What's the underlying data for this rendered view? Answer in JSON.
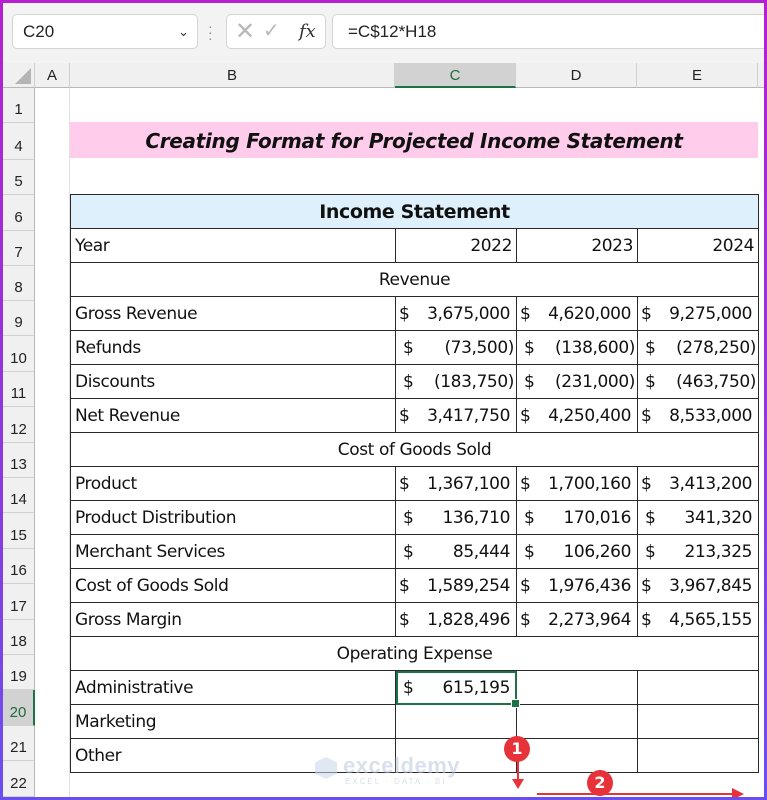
{
  "formula_bar": {
    "name_box": "C20",
    "name_box_chevron": "chevron-down-icon",
    "cancel_icon": "✕",
    "enter_icon": "✓",
    "fx_label": "fx",
    "formula": "=C$12*H18"
  },
  "columns": [
    {
      "label": "A",
      "selected": false
    },
    {
      "label": "B",
      "selected": false
    },
    {
      "label": "C",
      "selected": true
    },
    {
      "label": "D",
      "selected": false
    },
    {
      "label": "E",
      "selected": false
    }
  ],
  "rows": [
    "1",
    "4",
    "5",
    "6",
    "7",
    "8",
    "9",
    "10",
    "11",
    "12",
    "13",
    "14",
    "15",
    "16",
    "17",
    "18",
    "19",
    "20",
    "21",
    "22"
  ],
  "selected_row": "20",
  "sheet": {
    "title": "Creating Format for Projected Income Statement",
    "table_header": "Income Statement",
    "year_label": "Year",
    "years": [
      "2022",
      "2023",
      "2024"
    ],
    "sections": {
      "revenue": "Revenue",
      "cogs": "Cost of Goods Sold",
      "opex": "Operating Expense"
    },
    "revenue_rows": [
      {
        "label": "Gross Revenue",
        "values": [
          [
            "$",
            "3,675,000",
            "tight"
          ],
          [
            "$",
            "4,620,000",
            "tight"
          ],
          [
            "$",
            "9,275,000",
            "tight"
          ]
        ]
      },
      {
        "label": "Refunds",
        "values": [
          [
            "$",
            "(73,500)",
            "neg"
          ],
          [
            "$",
            "(138,600)",
            "neg"
          ],
          [
            "$",
            "(278,250)",
            "neg"
          ]
        ]
      },
      {
        "label": "Discounts",
        "values": [
          [
            "$",
            "(183,750)",
            "neg"
          ],
          [
            "$",
            "(231,000)",
            "neg"
          ],
          [
            "$",
            "(463,750)",
            "neg"
          ]
        ]
      },
      {
        "label": "Net Revenue",
        "values": [
          [
            "$",
            "3,417,750",
            "tight"
          ],
          [
            "$",
            "4,250,400",
            "tight"
          ],
          [
            "$",
            "8,533,000",
            "tight"
          ]
        ]
      }
    ],
    "cogs_rows": [
      {
        "label": "Product",
        "values": [
          [
            "$",
            "1,367,100",
            "tight"
          ],
          [
            "$",
            "1,700,160",
            "tight"
          ],
          [
            "$",
            "3,413,200",
            "tight"
          ]
        ]
      },
      {
        "label": "Product Distribution",
        "values": [
          [
            "$",
            "136,710",
            "pos"
          ],
          [
            "$",
            "170,016",
            "pos"
          ],
          [
            "$",
            "341,320",
            "pos"
          ]
        ]
      },
      {
        "label": "Merchant Services",
        "values": [
          [
            "$",
            "85,444",
            "pos"
          ],
          [
            "$",
            "106,260",
            "pos"
          ],
          [
            "$",
            "213,325",
            "pos"
          ]
        ]
      },
      {
        "label": "Cost of Goods Sold",
        "values": [
          [
            "$",
            "1,589,254",
            "tight"
          ],
          [
            "$",
            "1,976,436",
            "tight"
          ],
          [
            "$",
            "3,967,845",
            "tight"
          ]
        ]
      },
      {
        "label": "Gross Margin",
        "values": [
          [
            "$",
            "1,828,496",
            "tight"
          ],
          [
            "$",
            "2,273,964",
            "tight"
          ],
          [
            "$",
            "4,565,155",
            "tight"
          ]
        ]
      }
    ],
    "opex_rows": [
      {
        "label": "Administrative",
        "values": [
          [
            "$",
            "615,195",
            "pos"
          ],
          null,
          null
        ]
      },
      {
        "label": "Marketing",
        "values": [
          null,
          null,
          null
        ]
      },
      {
        "label": "Other",
        "values": [
          null,
          null,
          null
        ]
      }
    ]
  },
  "active_cell": "C20",
  "annotations": {
    "step1": "1",
    "step2": "2",
    "accent_color": "#e8323a"
  },
  "watermark": {
    "name": "exceldemy",
    "tagline": "EXCEL · DATA · BI"
  },
  "colors": {
    "title_band": "#ffccec",
    "table_header_bg": "#ddf0fb",
    "selection_green": "#1e7145"
  }
}
